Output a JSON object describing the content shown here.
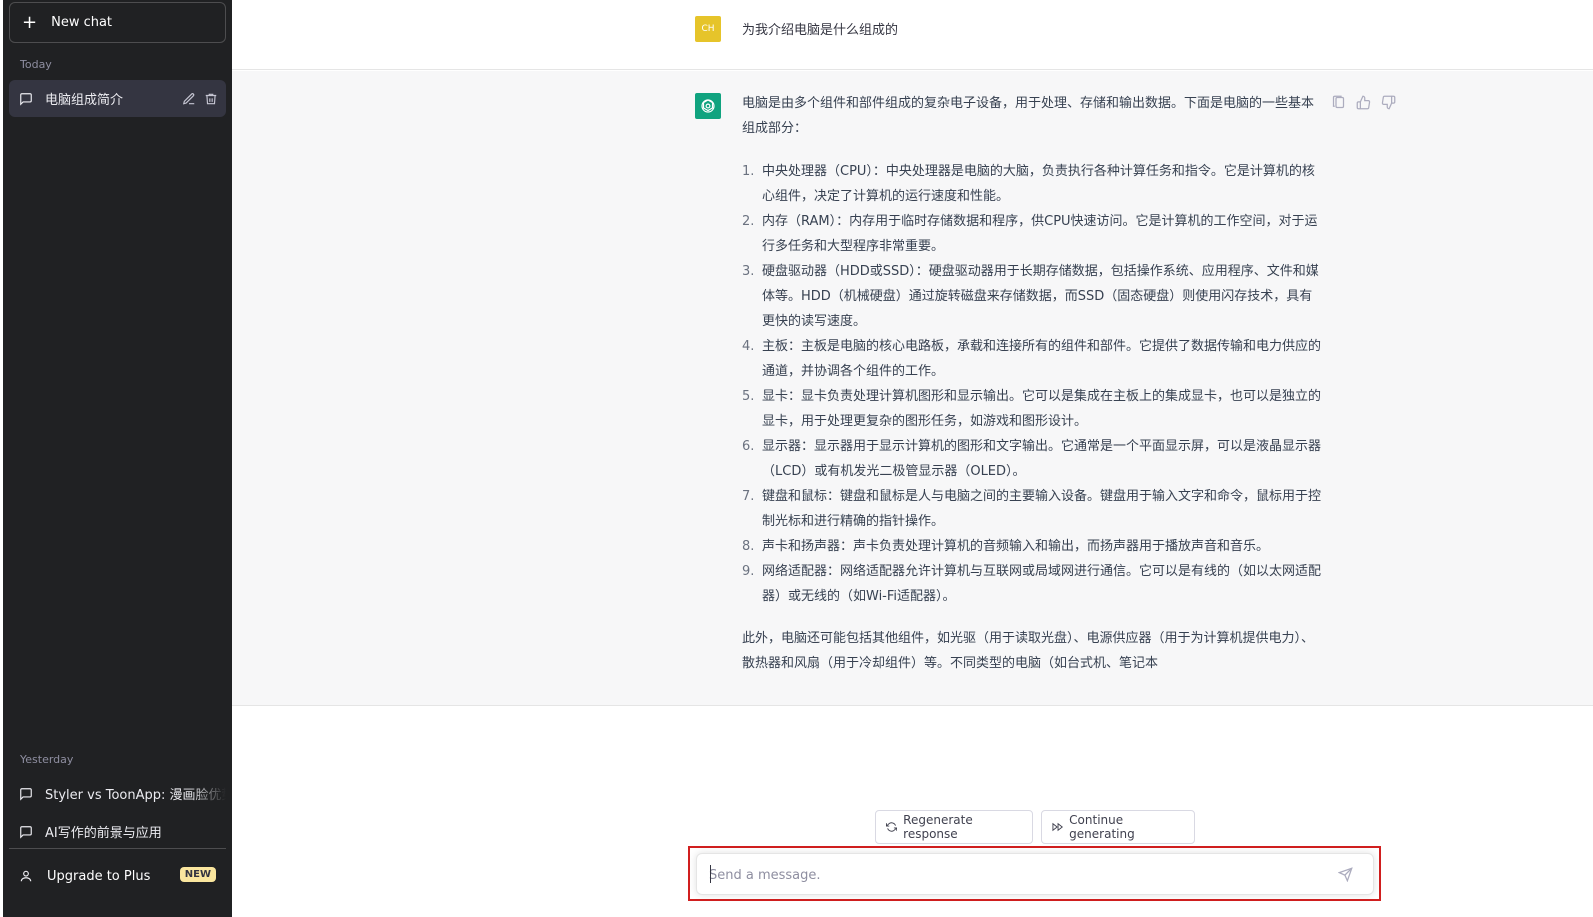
{
  "sidebar": {
    "new_chat_label": "New chat",
    "today_label": "Today",
    "yesterday_label": "Yesterday",
    "today_items": [
      {
        "label": "电脑组成简介"
      }
    ],
    "yesterday_items": [
      {
        "label": "Styler vs ToonApp: 漫画脸优势"
      },
      {
        "label": "AI写作的前景与应用"
      }
    ],
    "upgrade_label": "Upgrade to Plus",
    "new_badge": "NEW"
  },
  "conversation": {
    "user_avatar": "CH",
    "user_message": "为我介绍电脑是什么组成的",
    "assistant": {
      "intro": "电脑是由多个组件和部件组成的复杂电子设备，用于处理、存储和输出数据。下面是电脑的一些基本组成部分：",
      "items": [
        {
          "num": "1.",
          "text": "中央处理器（CPU）：中央处理器是电脑的大脑，负责执行各种计算任务和指令。它是计算机的核心组件，决定了计算机的运行速度和性能。"
        },
        {
          "num": "2.",
          "text": "内存（RAM）：内存用于临时存储数据和程序，供CPU快速访问。它是计算机的工作空间，对于运行多任务和大型程序非常重要。"
        },
        {
          "num": "3.",
          "text": "硬盘驱动器（HDD或SSD）：硬盘驱动器用于长期存储数据，包括操作系统、应用程序、文件和媒体等。HDD（机械硬盘）通过旋转磁盘来存储数据，而SSD（固态硬盘）则使用闪存技术，具有更快的读写速度。"
        },
        {
          "num": "4.",
          "text": "主板：主板是电脑的核心电路板，承载和连接所有的组件和部件。它提供了数据传输和电力供应的通道，并协调各个组件的工作。"
        },
        {
          "num": "5.",
          "text": "显卡：显卡负责处理计算机图形和显示输出。它可以是集成在主板上的集成显卡，也可以是独立的显卡，用于处理更复杂的图形任务，如游戏和图形设计。"
        },
        {
          "num": "6.",
          "text": "显示器：显示器用于显示计算机的图形和文字输出。它通常是一个平面显示屏，可以是液晶显示器（LCD）或有机发光二极管显示器（OLED）。"
        },
        {
          "num": "7.",
          "text": "键盘和鼠标：键盘和鼠标是人与电脑之间的主要输入设备。键盘用于输入文字和命令，鼠标用于控制光标和进行精确的指针操作。"
        },
        {
          "num": "8.",
          "text": "声卡和扬声器：声卡负责处理计算机的音频输入和输出，而扬声器用于播放声音和音乐。"
        },
        {
          "num": "9.",
          "text": "网络适配器：网络适配器允许计算机与互联网或局域网进行通信。它可以是有线的（如以太网适配器）或无线的（如Wi-Fi适配器）。"
        }
      ],
      "outro": "此外，电脑还可能包括其他组件，如光驱（用于读取光盘）、电源供应器（用于为计算机提供电力）、散热器和风扇（用于冷却组件）等。不同类型的电脑（如台式机、笔记本"
    }
  },
  "actions": {
    "regenerate_label": "Regenerate response",
    "continue_label": "Continue generating"
  },
  "composer": {
    "placeholder": "Send a message."
  },
  "colors": {
    "sidebar_bg": "#202123",
    "user_avatar_bg": "#e6c42a",
    "gpt_avatar_bg": "#10a37f",
    "highlight": "#d11f1f"
  }
}
